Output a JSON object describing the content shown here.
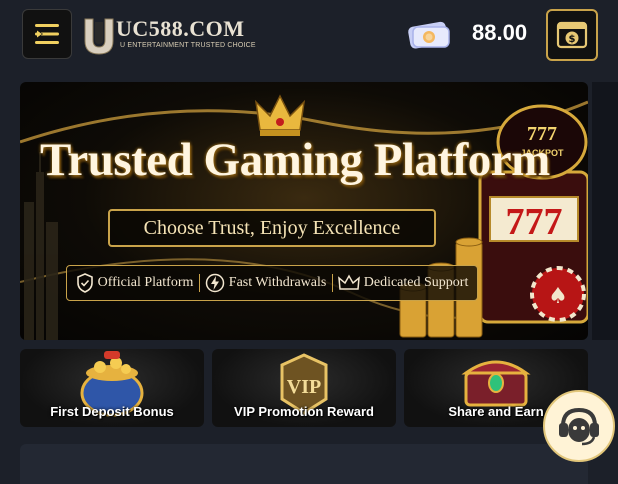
{
  "header": {
    "brand_name": "UC588.COM",
    "brand_tagline": "U ENTERTAINMENT TRUSTED CHOICE",
    "balance": "88.00",
    "icons": [
      "menu-icon",
      "wallet-icon",
      "cashier-icon"
    ]
  },
  "banner": {
    "headline": "Trusted Gaming Platform",
    "subheadline": "Choose Trust, Enjoy Excellence",
    "features": [
      {
        "label": "Official Platform",
        "icon": "shield-check-icon"
      },
      {
        "label": "Fast Withdrawals",
        "icon": "lightning-icon"
      },
      {
        "label": "Dedicated Support",
        "icon": "crown-icon"
      }
    ],
    "jackpot_label": "777 JACKPOT",
    "slot_symbols": "777"
  },
  "promotions": [
    {
      "label": "First Deposit Bonus",
      "icon": "treasure-pot-icon"
    },
    {
      "label": "VIP Promotion Reward",
      "icon": "vip-badge-icon"
    },
    {
      "label": "Share and Earn",
      "icon": "treasure-chest-icon"
    }
  ],
  "support": {
    "icon": "customer-support-icon"
  },
  "colors": {
    "background": "#1c2029",
    "gold": "#c9a34a",
    "accent_light": "#fff3d6"
  }
}
